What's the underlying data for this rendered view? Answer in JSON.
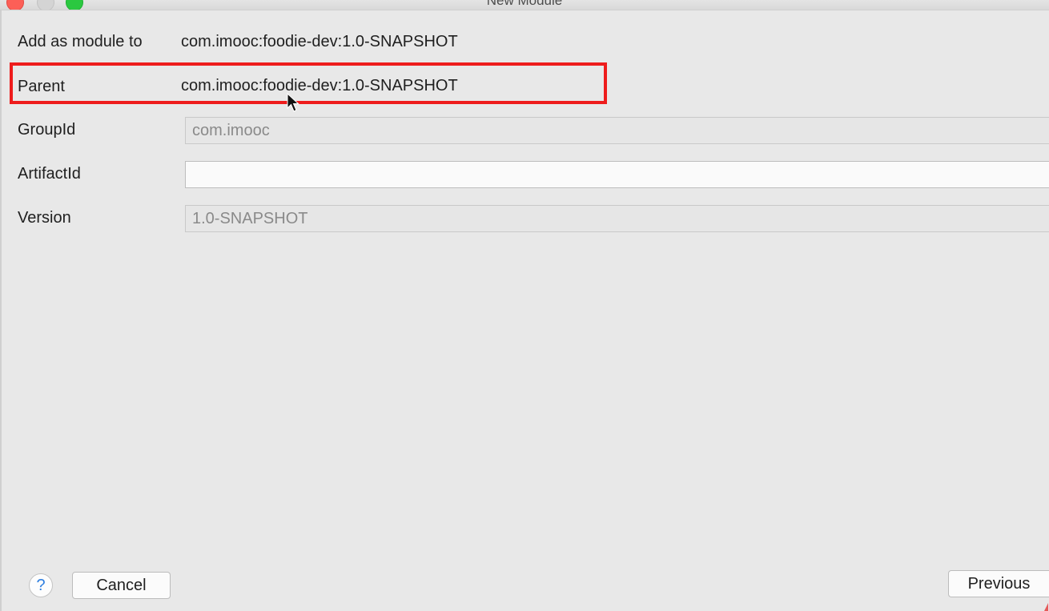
{
  "window": {
    "title": "New Module"
  },
  "form": {
    "add_as_module_label": "Add as module to",
    "add_as_module_value": "com.imooc:foodie-dev:1.0-SNAPSHOT",
    "parent_label": "Parent",
    "parent_value": "com.imooc:foodie-dev:1.0-SNAPSHOT",
    "group_id_label": "GroupId",
    "group_id_value": "com.imooc",
    "artifact_id_label": "ArtifactId",
    "artifact_id_value": "",
    "version_label": "Version",
    "version_value": "1.0-SNAPSHOT"
  },
  "buttons": {
    "help_label": "?",
    "cancel_label": "Cancel",
    "previous_label": "Previous"
  },
  "colors": {
    "highlight": "#ee1c1c",
    "background": "#e8e8e8",
    "help_icon": "#2f7fe0"
  },
  "icons": {
    "close": "close-window-icon",
    "minimize": "minimize-window-icon",
    "maximize": "maximize-window-icon",
    "pointer": "mouse-pointer-icon",
    "help": "help-icon"
  }
}
